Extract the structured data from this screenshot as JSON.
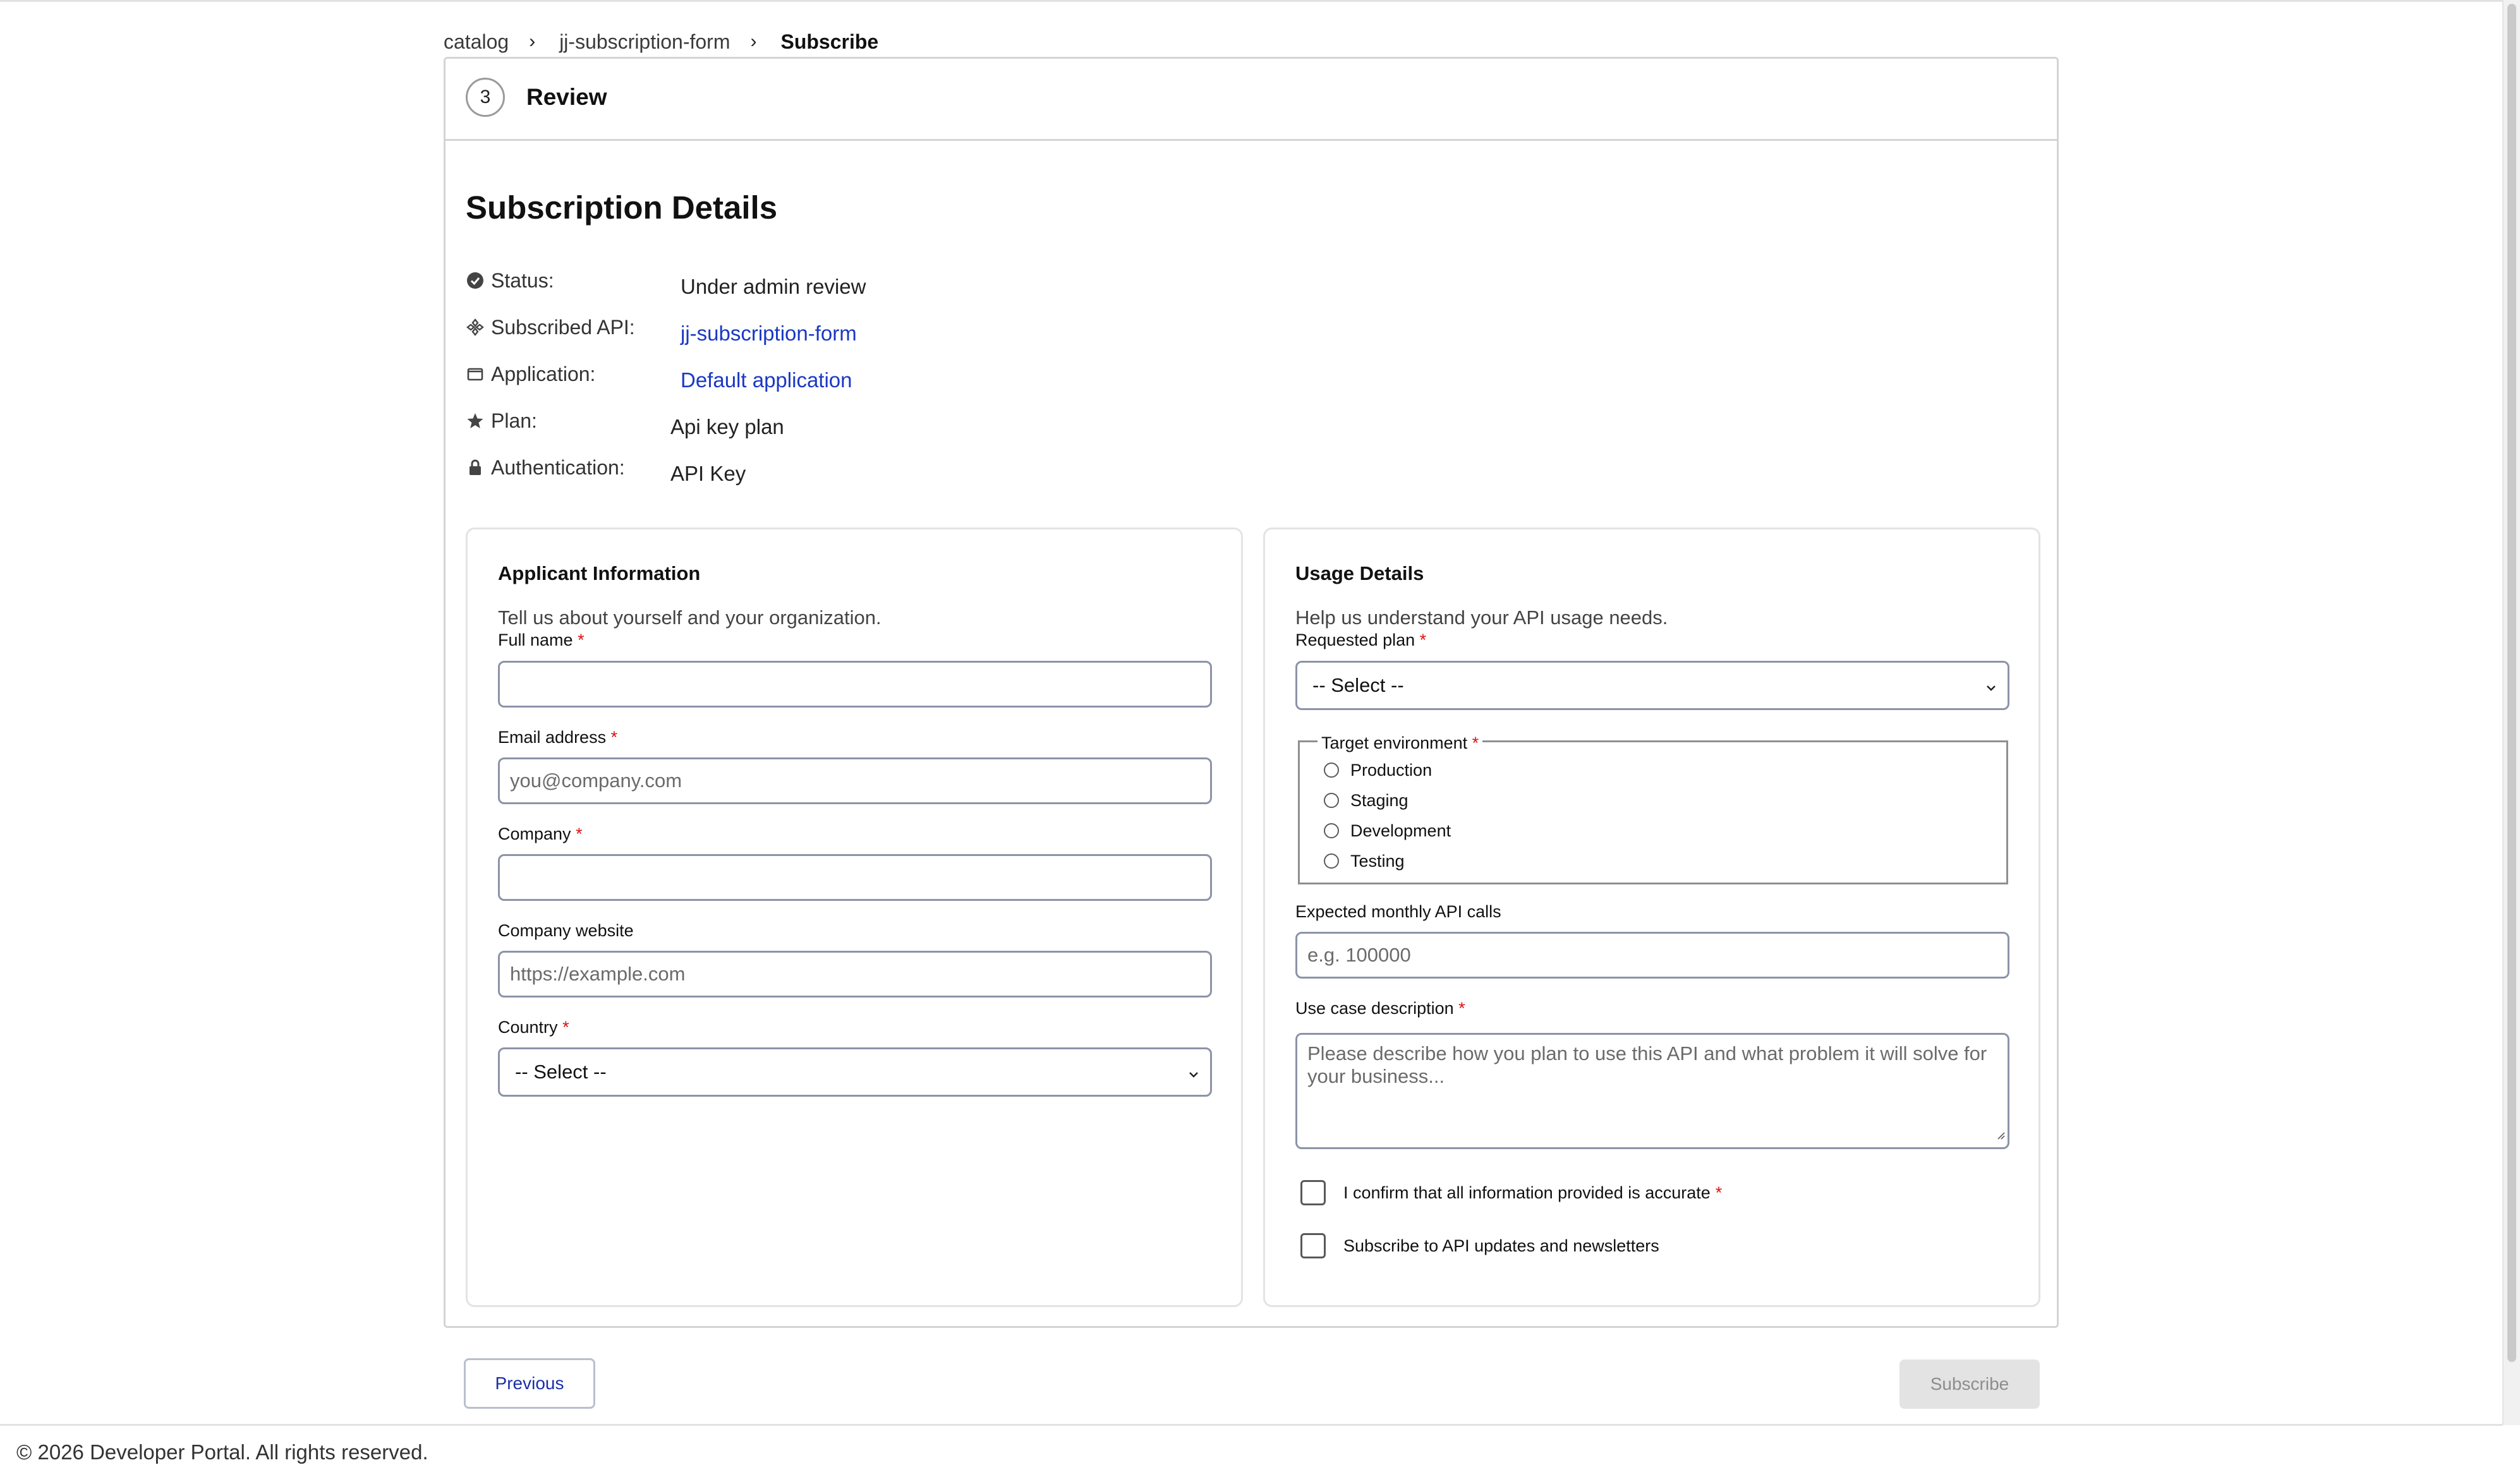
{
  "breadcrumb": {
    "items": [
      "catalog",
      "jj-subscription-form"
    ],
    "current": "Subscribe",
    "separator": "›"
  },
  "step": {
    "number": "3",
    "title": "Review"
  },
  "subscription": {
    "title": "Subscription Details",
    "rows": [
      {
        "icon": "check-circle-icon",
        "label": "Status:",
        "value": "Under admin review"
      },
      {
        "icon": "api-icon",
        "label": "Subscribed API:",
        "value": "jj-subscription-form"
      },
      {
        "icon": "window-icon",
        "label": "Application:",
        "value": "Default application"
      },
      {
        "icon": "star-icon",
        "label": "Plan:",
        "value": "Api key plan"
      },
      {
        "icon": "lock-icon",
        "label": "Authentication:",
        "value": "API Key"
      }
    ]
  },
  "applicant": {
    "title": "Applicant Information",
    "description": "Tell us about yourself and your organization.",
    "full_name": {
      "label": "Full name",
      "placeholder": ""
    },
    "email": {
      "label": "Email address",
      "placeholder": "you@company.com"
    },
    "company": {
      "label": "Company",
      "placeholder": ""
    },
    "website": {
      "label": "Company website",
      "placeholder": "https://example.com"
    },
    "country": {
      "label": "Country",
      "value": "-- Select --"
    }
  },
  "usage": {
    "title": "Usage Details",
    "description": "Help us understand your API usage needs.",
    "requested_plan": {
      "label": "Requested plan",
      "value": "-- Select --"
    },
    "environment": {
      "label": "Target environment",
      "options": [
        "Production",
        "Staging",
        "Development",
        "Testing"
      ]
    },
    "monthly_calls": {
      "label": "Expected monthly API calls",
      "placeholder": "e.g. 100000"
    },
    "use_case": {
      "label": "Use case description",
      "placeholder": "Please describe how you plan to use this API and what problem it will solve for your business..."
    },
    "confirm_label": "I confirm that all information provided is accurate",
    "newsletter_label": "Subscribe to API updates and newsletters"
  },
  "required_marker": "*",
  "actions": {
    "previous": "Previous",
    "subscribe": "Subscribe"
  },
  "footer": {
    "text": "© 2026 Developer Portal. All rights reserved."
  },
  "colors": {
    "link": "#1a38c4",
    "required": "#dd1111",
    "border": "#8c93a8"
  }
}
